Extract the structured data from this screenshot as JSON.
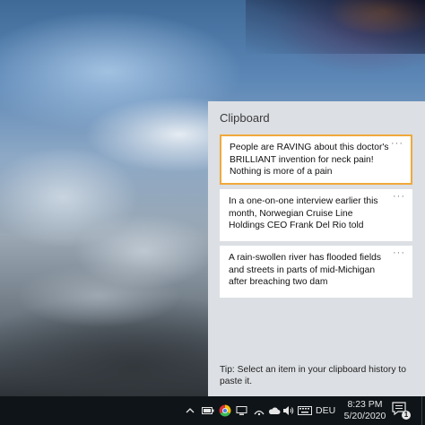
{
  "clipboard": {
    "title": "Clipboard",
    "items": [
      {
        "text": "People are RAVING about this doctor's BRILLIANT invention for neck pain! Nothing is more of a pain",
        "selected": true
      },
      {
        "text": "In a one-on-one interview earlier this month, Norwegian Cruise Line Holdings CEO Frank Del Rio told",
        "selected": false
      },
      {
        "text": "A rain-swollen river has flooded fields and streets in parts of mid-Michigan after breaching two dam",
        "selected": false
      }
    ],
    "more_label": "···",
    "tip": "Tip: Select an item in your clipboard history to paste it."
  },
  "taskbar": {
    "tray_icons": [
      "chevron-up-icon",
      "battery-icon",
      "chrome-icon",
      "onedrive-icon",
      "network-icon",
      "cloud-icon",
      "volume-icon",
      "keyboard-icon"
    ],
    "language": "DEU",
    "time": "8:23 PM",
    "date": "5/20/2020",
    "notification_count": "1"
  },
  "colors": {
    "selection_border": "#f0a93b",
    "flyout_background": "#dcdfe3",
    "taskbar_background": "#0f1418"
  }
}
